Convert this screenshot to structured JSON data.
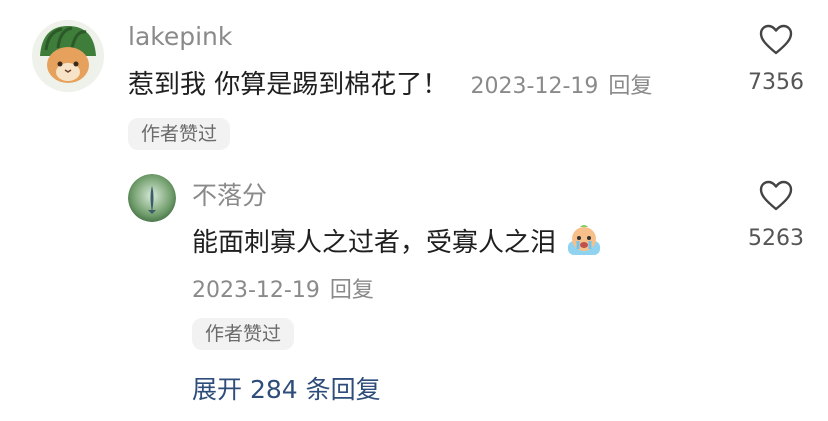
{
  "comments": [
    {
      "username": "lakepink",
      "text": "惹到我 你算是踢到棉花了！",
      "date": "2023-12-19",
      "reply_label": "回复",
      "badge": "作者赞过",
      "like_count": "7356",
      "avatar_icon": "watermelon-cat-avatar"
    }
  ],
  "reply": {
    "username": "不落分",
    "text": "能面刺寡人之过者，受寡人之泪",
    "emoji_icon": "crying-emoji-icon",
    "date": "2023-12-19",
    "reply_label": "回复",
    "badge": "作者赞过",
    "like_count": "5263",
    "avatar_icon": "green-fish-avatar"
  },
  "expand": {
    "label": "展开 284 条回复"
  },
  "colors": {
    "meta_gray": "#8a8a8a",
    "expand_blue": "#2f4d7a",
    "badge_bg": "#f2f2f2"
  }
}
